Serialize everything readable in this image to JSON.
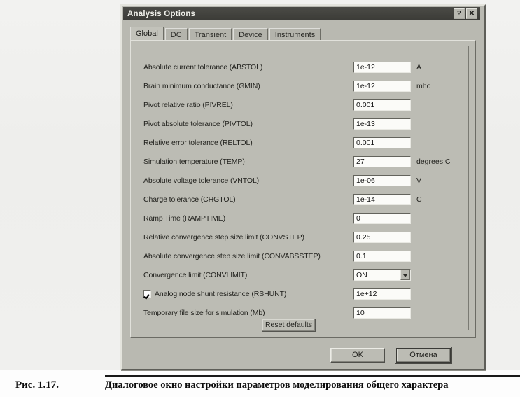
{
  "dialog": {
    "title": "Analysis Options",
    "title_buttons": [
      {
        "name": "help-button",
        "glyph": "?"
      },
      {
        "name": "close-button",
        "glyph": "✕"
      }
    ],
    "tabs": [
      {
        "label": "Global",
        "active": true
      },
      {
        "label": "DC",
        "active": false
      },
      {
        "label": "Transient",
        "active": false
      },
      {
        "label": "Device",
        "active": false
      },
      {
        "label": "Instruments",
        "active": false
      }
    ],
    "rows": [
      {
        "label": "Absolute current tolerance (ABSTOL)",
        "value": "1e-12",
        "unit": "A",
        "control": "text",
        "checkbox": null
      },
      {
        "label": "Brain minimum conductance (GMIN)",
        "value": "1e-12",
        "unit": "mho",
        "control": "text",
        "checkbox": null
      },
      {
        "label": "Pivot relative ratio (PIVREL)",
        "value": "0.001",
        "unit": "",
        "control": "text",
        "checkbox": null
      },
      {
        "label": "Pivot absolute tolerance (PIVTOL)",
        "value": "1e-13",
        "unit": "",
        "control": "text",
        "checkbox": null
      },
      {
        "label": "Relative error tolerance (RELTOL)",
        "value": "0.001",
        "unit": "",
        "control": "text",
        "checkbox": null
      },
      {
        "label": "Simulation temperature (TEMP)",
        "value": "27",
        "unit": "degrees C",
        "control": "text",
        "checkbox": null
      },
      {
        "label": "Absolute voltage tolerance (VNTOL)",
        "value": "1e-06",
        "unit": "V",
        "control": "text",
        "checkbox": null
      },
      {
        "label": "Charge tolerance (CHGTOL)",
        "value": "1e-14",
        "unit": "C",
        "control": "text",
        "checkbox": null
      },
      {
        "label": "Ramp Time (RAMPTIME)",
        "value": "0",
        "unit": "",
        "control": "text",
        "checkbox": null
      },
      {
        "label": "Relative convergence step size limit (CONVSTEP)",
        "value": "0.25",
        "unit": "",
        "control": "text",
        "checkbox": null
      },
      {
        "label": "Absolute convergence step size limit (CONVABSSTEP)",
        "value": "0.1",
        "unit": "",
        "control": "text",
        "checkbox": null
      },
      {
        "label": "Convergence limit (CONVLIMIT)",
        "value": "ON",
        "unit": "",
        "control": "combo",
        "checkbox": null
      },
      {
        "label": "Analog node shunt resistance (RSHUNT)",
        "value": "1e+12",
        "unit": "",
        "control": "text",
        "checkbox": true
      },
      {
        "label": "Temporary file size for simulation (Mb)",
        "value": "10",
        "unit": "",
        "control": "text",
        "checkbox": null
      }
    ],
    "reset_label": "Reset defaults",
    "ok_label": "OK",
    "cancel_label": "Отмена"
  },
  "caption": {
    "figure_number": "Рис. 1.17.",
    "figure_text": "Диалоговое окно настройки параметров моделирования общего характера"
  },
  "colors": {
    "dialog_face": "#b9b9b1",
    "titlebar": "#3f3f3a",
    "field_bg": "#fbfbf8",
    "text": "#23231f"
  }
}
